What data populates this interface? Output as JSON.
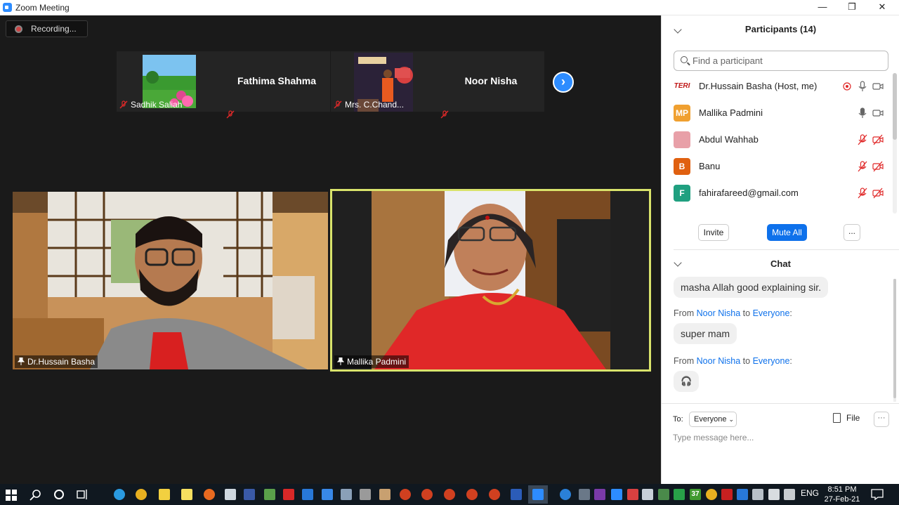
{
  "window": {
    "title": "Zoom Meeting",
    "minimize": "—",
    "maximize": "❐",
    "close": "✕"
  },
  "recording": {
    "label": "Recording..."
  },
  "thumbnails": [
    {
      "name": "Sadhik Saliah",
      "has_video": true
    },
    {
      "name": "Fathima Shahma",
      "has_video": false
    },
    {
      "name": "Mrs. C.Chand...",
      "has_video": true
    },
    {
      "name": "Noor Nisha",
      "has_video": false
    }
  ],
  "videos": [
    {
      "name": "Dr.Hussain Basha"
    },
    {
      "name": "Mallika Padmini"
    }
  ],
  "participants": {
    "title": "Participants (14)",
    "search_placeholder": "Find a participant",
    "list": [
      {
        "name": "Dr.Hussain Basha (Host, me)",
        "avatar_text": "TERI",
        "avatar_color": "#ffffff",
        "recording": true,
        "mic_muted": false,
        "video_off": false
      },
      {
        "name": "Mallika Padmini",
        "avatar_text": "MP",
        "avatar_color": "#f0a030",
        "recording": false,
        "mic_muted": false,
        "video_off": false
      },
      {
        "name": "Abdul Wahhab",
        "avatar_text": "",
        "avatar_color": "#e8a0a8",
        "recording": false,
        "mic_muted": true,
        "video_off": true
      },
      {
        "name": "Banu",
        "avatar_text": "B",
        "avatar_color": "#e06010",
        "recording": false,
        "mic_muted": true,
        "video_off": true
      },
      {
        "name": "fahirafareed@gmail.com",
        "avatar_text": "F",
        "avatar_color": "#20a080",
        "recording": false,
        "mic_muted": true,
        "video_off": true
      }
    ],
    "invite_label": "Invite",
    "mute_all_label": "Mute All",
    "more_label": "..."
  },
  "chat": {
    "title": "Chat",
    "messages": [
      {
        "from": "",
        "to": "",
        "text": "masha Allah good explaining sir."
      },
      {
        "from": "Noor Nisha",
        "to": "Everyone",
        "text": "super mam"
      },
      {
        "from": "Noor Nisha",
        "to": "Everyone",
        "text": "🎧"
      }
    ],
    "from_word": "From",
    "to_word": "to",
    "to_label": "To:",
    "recipient": "Everyone",
    "file_label": "File",
    "more_label": "···",
    "input_placeholder": "Type message here..."
  },
  "taskbar": {
    "language": "ENG",
    "time": "8:51 PM",
    "date": "27-Feb-21",
    "badge": "37"
  },
  "colors": {
    "accent": "#2d8cff",
    "active_speaker": "#d9e36b",
    "muted": "#e02828"
  }
}
